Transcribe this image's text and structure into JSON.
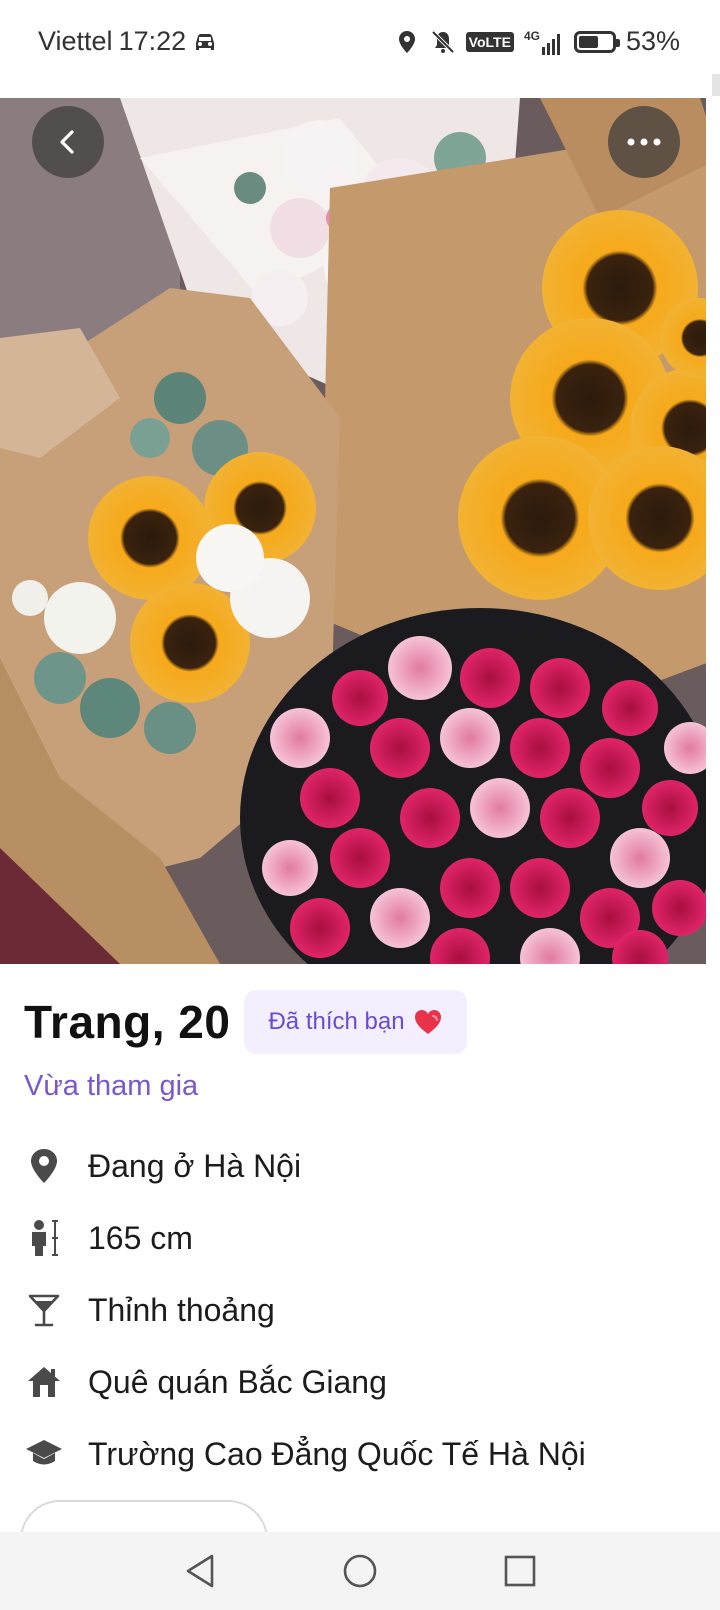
{
  "status_bar": {
    "carrier": "Viettel",
    "time": "17:22",
    "network": "4G",
    "volte": "VoLTE",
    "battery": "53%",
    "battery_level": 0.53,
    "icons": [
      "car-icon",
      "location-icon",
      "bell-muted-icon",
      "volte-icon",
      "signal-icon",
      "battery-icon"
    ]
  },
  "photo": {
    "description_icon": "flower-bouquets-photo"
  },
  "profile": {
    "name_age": "Trang, 20",
    "liked_badge": "Đã thích bạn",
    "liked_badge_icon": "heart-icon",
    "joined": "Vừa tham gia",
    "details": [
      {
        "icon": "location-pin-icon",
        "text": "Đang ở Hà Nội"
      },
      {
        "icon": "height-icon",
        "text": "165 cm"
      },
      {
        "icon": "cocktail-icon",
        "text": "Thỉnh thoảng"
      },
      {
        "icon": "home-icon",
        "text": "Quê quán Bắc Giang"
      },
      {
        "icon": "graduation-cap-icon",
        "text": "Trường Cao Đẳng Quốc Tế Hà Nội"
      }
    ]
  },
  "colors": {
    "accent": "#7a57d1",
    "badge_bg": "#f3efff",
    "badge_text": "#6b4bd6"
  }
}
